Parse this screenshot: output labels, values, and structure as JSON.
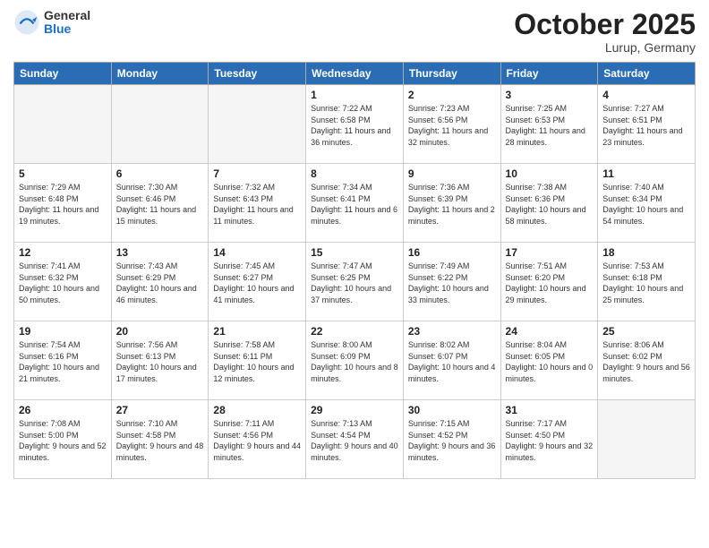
{
  "header": {
    "logo_general": "General",
    "logo_blue": "Blue",
    "month": "October 2025",
    "location": "Lurup, Germany"
  },
  "weekdays": [
    "Sunday",
    "Monday",
    "Tuesday",
    "Wednesday",
    "Thursday",
    "Friday",
    "Saturday"
  ],
  "weeks": [
    [
      {
        "day": "",
        "sunrise": "",
        "sunset": "",
        "daylight": "",
        "empty": true
      },
      {
        "day": "",
        "sunrise": "",
        "sunset": "",
        "daylight": "",
        "empty": true
      },
      {
        "day": "",
        "sunrise": "",
        "sunset": "",
        "daylight": "",
        "empty": true
      },
      {
        "day": "1",
        "sunrise": "Sunrise: 7:22 AM",
        "sunset": "Sunset: 6:58 PM",
        "daylight": "Daylight: 11 hours and 36 minutes."
      },
      {
        "day": "2",
        "sunrise": "Sunrise: 7:23 AM",
        "sunset": "Sunset: 6:56 PM",
        "daylight": "Daylight: 11 hours and 32 minutes."
      },
      {
        "day": "3",
        "sunrise": "Sunrise: 7:25 AM",
        "sunset": "Sunset: 6:53 PM",
        "daylight": "Daylight: 11 hours and 28 minutes."
      },
      {
        "day": "4",
        "sunrise": "Sunrise: 7:27 AM",
        "sunset": "Sunset: 6:51 PM",
        "daylight": "Daylight: 11 hours and 23 minutes."
      }
    ],
    [
      {
        "day": "5",
        "sunrise": "Sunrise: 7:29 AM",
        "sunset": "Sunset: 6:48 PM",
        "daylight": "Daylight: 11 hours and 19 minutes."
      },
      {
        "day": "6",
        "sunrise": "Sunrise: 7:30 AM",
        "sunset": "Sunset: 6:46 PM",
        "daylight": "Daylight: 11 hours and 15 minutes."
      },
      {
        "day": "7",
        "sunrise": "Sunrise: 7:32 AM",
        "sunset": "Sunset: 6:43 PM",
        "daylight": "Daylight: 11 hours and 11 minutes."
      },
      {
        "day": "8",
        "sunrise": "Sunrise: 7:34 AM",
        "sunset": "Sunset: 6:41 PM",
        "daylight": "Daylight: 11 hours and 6 minutes."
      },
      {
        "day": "9",
        "sunrise": "Sunrise: 7:36 AM",
        "sunset": "Sunset: 6:39 PM",
        "daylight": "Daylight: 11 hours and 2 minutes."
      },
      {
        "day": "10",
        "sunrise": "Sunrise: 7:38 AM",
        "sunset": "Sunset: 6:36 PM",
        "daylight": "Daylight: 10 hours and 58 minutes."
      },
      {
        "day": "11",
        "sunrise": "Sunrise: 7:40 AM",
        "sunset": "Sunset: 6:34 PM",
        "daylight": "Daylight: 10 hours and 54 minutes."
      }
    ],
    [
      {
        "day": "12",
        "sunrise": "Sunrise: 7:41 AM",
        "sunset": "Sunset: 6:32 PM",
        "daylight": "Daylight: 10 hours and 50 minutes."
      },
      {
        "day": "13",
        "sunrise": "Sunrise: 7:43 AM",
        "sunset": "Sunset: 6:29 PM",
        "daylight": "Daylight: 10 hours and 46 minutes."
      },
      {
        "day": "14",
        "sunrise": "Sunrise: 7:45 AM",
        "sunset": "Sunset: 6:27 PM",
        "daylight": "Daylight: 10 hours and 41 minutes."
      },
      {
        "day": "15",
        "sunrise": "Sunrise: 7:47 AM",
        "sunset": "Sunset: 6:25 PM",
        "daylight": "Daylight: 10 hours and 37 minutes."
      },
      {
        "day": "16",
        "sunrise": "Sunrise: 7:49 AM",
        "sunset": "Sunset: 6:22 PM",
        "daylight": "Daylight: 10 hours and 33 minutes."
      },
      {
        "day": "17",
        "sunrise": "Sunrise: 7:51 AM",
        "sunset": "Sunset: 6:20 PM",
        "daylight": "Daylight: 10 hours and 29 minutes."
      },
      {
        "day": "18",
        "sunrise": "Sunrise: 7:53 AM",
        "sunset": "Sunset: 6:18 PM",
        "daylight": "Daylight: 10 hours and 25 minutes."
      }
    ],
    [
      {
        "day": "19",
        "sunrise": "Sunrise: 7:54 AM",
        "sunset": "Sunset: 6:16 PM",
        "daylight": "Daylight: 10 hours and 21 minutes."
      },
      {
        "day": "20",
        "sunrise": "Sunrise: 7:56 AM",
        "sunset": "Sunset: 6:13 PM",
        "daylight": "Daylight: 10 hours and 17 minutes."
      },
      {
        "day": "21",
        "sunrise": "Sunrise: 7:58 AM",
        "sunset": "Sunset: 6:11 PM",
        "daylight": "Daylight: 10 hours and 12 minutes."
      },
      {
        "day": "22",
        "sunrise": "Sunrise: 8:00 AM",
        "sunset": "Sunset: 6:09 PM",
        "daylight": "Daylight: 10 hours and 8 minutes."
      },
      {
        "day": "23",
        "sunrise": "Sunrise: 8:02 AM",
        "sunset": "Sunset: 6:07 PM",
        "daylight": "Daylight: 10 hours and 4 minutes."
      },
      {
        "day": "24",
        "sunrise": "Sunrise: 8:04 AM",
        "sunset": "Sunset: 6:05 PM",
        "daylight": "Daylight: 10 hours and 0 minutes."
      },
      {
        "day": "25",
        "sunrise": "Sunrise: 8:06 AM",
        "sunset": "Sunset: 6:02 PM",
        "daylight": "Daylight: 9 hours and 56 minutes."
      }
    ],
    [
      {
        "day": "26",
        "sunrise": "Sunrise: 7:08 AM",
        "sunset": "Sunset: 5:00 PM",
        "daylight": "Daylight: 9 hours and 52 minutes."
      },
      {
        "day": "27",
        "sunrise": "Sunrise: 7:10 AM",
        "sunset": "Sunset: 4:58 PM",
        "daylight": "Daylight: 9 hours and 48 minutes."
      },
      {
        "day": "28",
        "sunrise": "Sunrise: 7:11 AM",
        "sunset": "Sunset: 4:56 PM",
        "daylight": "Daylight: 9 hours and 44 minutes."
      },
      {
        "day": "29",
        "sunrise": "Sunrise: 7:13 AM",
        "sunset": "Sunset: 4:54 PM",
        "daylight": "Daylight: 9 hours and 40 minutes."
      },
      {
        "day": "30",
        "sunrise": "Sunrise: 7:15 AM",
        "sunset": "Sunset: 4:52 PM",
        "daylight": "Daylight: 9 hours and 36 minutes."
      },
      {
        "day": "31",
        "sunrise": "Sunrise: 7:17 AM",
        "sunset": "Sunset: 4:50 PM",
        "daylight": "Daylight: 9 hours and 32 minutes."
      },
      {
        "day": "",
        "sunrise": "",
        "sunset": "",
        "daylight": "",
        "empty": true
      }
    ]
  ]
}
